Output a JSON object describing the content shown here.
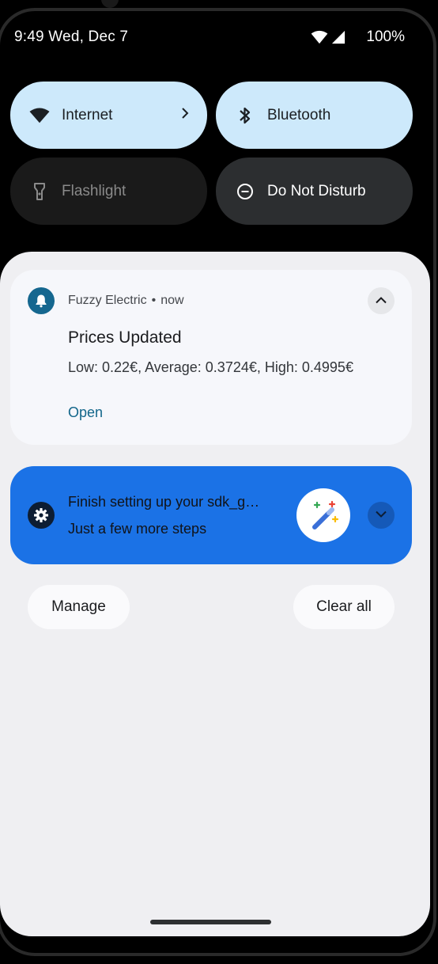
{
  "status_bar": {
    "time": "9:49 Wed, Dec 7",
    "battery": "100%"
  },
  "quick_settings": {
    "tiles": [
      {
        "label": "Internet",
        "icon": "wifi-icon",
        "state": "on"
      },
      {
        "label": "Bluetooth",
        "icon": "bluetooth-icon",
        "state": "on"
      },
      {
        "label": "Flashlight",
        "icon": "flashlight-icon",
        "state": "off"
      },
      {
        "label": "Do Not Disturb",
        "icon": "do-not-disturb-icon",
        "state": "off"
      }
    ]
  },
  "notifications": [
    {
      "app": "Fuzzy Electric",
      "separator": "•",
      "time": "now",
      "title": "Prices Updated",
      "body": "Low: 0.22€,  Average: 0.3724€, High: 0.4995€",
      "action": "Open",
      "icon": "bell-icon",
      "expanded": true
    },
    {
      "title": "Finish setting up your sdk_g…",
      "body": "Just a few more steps",
      "icon": "gear-icon",
      "large_icon": "magic-wand-icon",
      "expanded": false
    }
  ],
  "footer": {
    "manage": "Manage",
    "clear_all": "Clear all"
  },
  "colors": {
    "tile_on": "#cde9fb",
    "tile_off": "#1a1a1a",
    "panel": "#efeff2",
    "accent_blue": "#1b72e6",
    "app_icon": "#15678f",
    "action_text": "#12668a"
  }
}
